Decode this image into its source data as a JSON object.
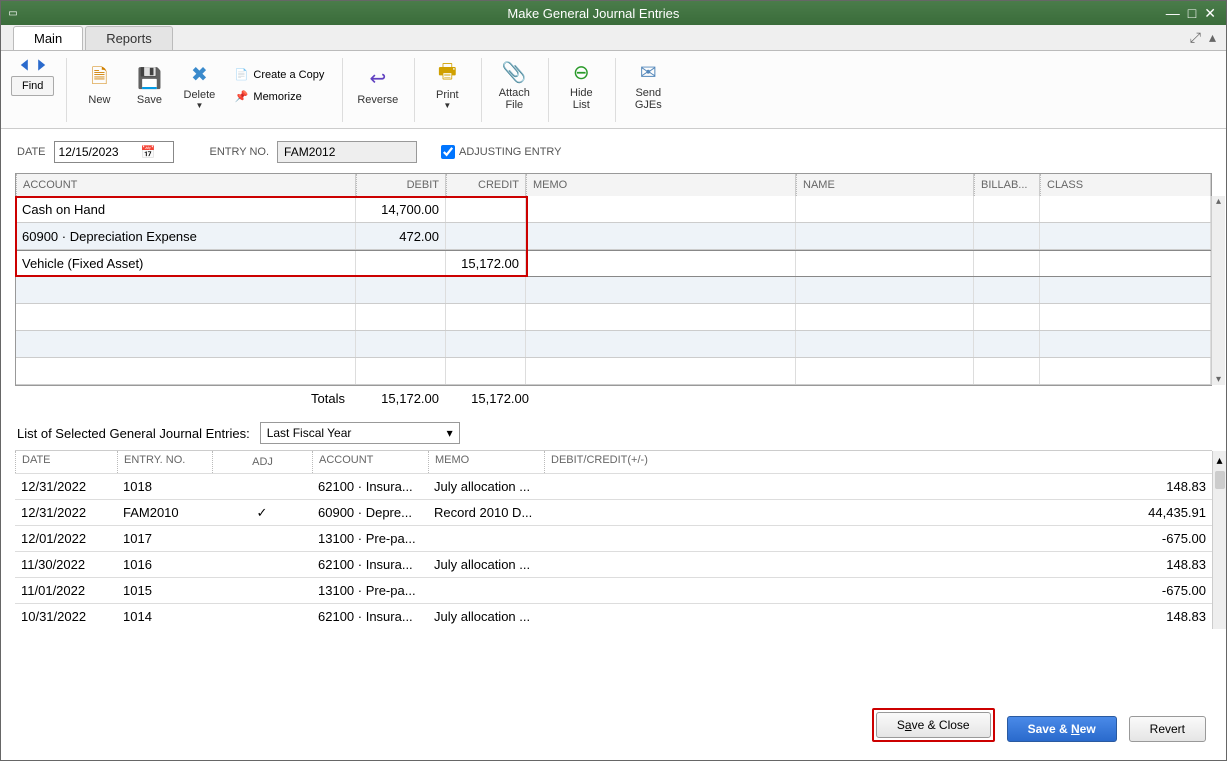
{
  "window": {
    "title": "Make General Journal Entries"
  },
  "tabs": {
    "main": "Main",
    "reports": "Reports"
  },
  "toolbar": {
    "find": "Find",
    "new": "New",
    "save": "Save",
    "delete": "Delete",
    "create_copy": "Create a Copy",
    "memorize": "Memorize",
    "reverse": "Reverse",
    "print": "Print",
    "attach_file_l1": "Attach",
    "attach_file_l2": "File",
    "hide_list_l1": "Hide",
    "hide_list_l2": "List",
    "send_gjes_l1": "Send",
    "send_gjes_l2": "GJEs"
  },
  "form": {
    "date_label": "DATE",
    "date_value": "12/15/2023",
    "entry_no_label": "ENTRY NO.",
    "entry_no_value": "FAM2012",
    "adjusting_label": "ADJUSTING ENTRY"
  },
  "grid_headers": {
    "account": "ACCOUNT",
    "debit": "DEBIT",
    "credit": "CREDIT",
    "memo": "MEMO",
    "name": "NAME",
    "billable": "BILLAB...",
    "class": "CLASS"
  },
  "entries": [
    {
      "account": "Cash on Hand",
      "debit": "14,700.00",
      "credit": ""
    },
    {
      "account": "60900 · Depreciation Expense",
      "debit": "472.00",
      "credit": ""
    },
    {
      "account": "Vehicle (Fixed Asset)",
      "debit": "",
      "credit": "15,172.00"
    }
  ],
  "totals": {
    "label": "Totals",
    "debit": "15,172.00",
    "credit": "15,172.00"
  },
  "list": {
    "title": "List of Selected General Journal Entries:",
    "dropdown_value": "Last Fiscal Year",
    "headers": {
      "date": "DATE",
      "entry": "ENTRY. NO.",
      "adj": "ADJ",
      "account": "ACCOUNT",
      "memo": "MEMO",
      "dc": "DEBIT/CREDIT(+/-)"
    },
    "rows": [
      {
        "date": "12/31/2022",
        "entry": "1018",
        "adj": "",
        "account": "62100 · Insura...",
        "memo": "July allocation ...",
        "dc": "148.83"
      },
      {
        "date": "12/31/2022",
        "entry": "FAM2010",
        "adj": "✓",
        "account": "60900 · Depre...",
        "memo": "Record 2010 D...",
        "dc": "44,435.91"
      },
      {
        "date": "12/01/2022",
        "entry": "1017",
        "adj": "",
        "account": "13100 · Pre-pa...",
        "memo": "",
        "dc": "-675.00"
      },
      {
        "date": "11/30/2022",
        "entry": "1016",
        "adj": "",
        "account": "62100 · Insura...",
        "memo": "July allocation ...",
        "dc": "148.83"
      },
      {
        "date": "11/01/2022",
        "entry": "1015",
        "adj": "",
        "account": "13100 · Pre-pa...",
        "memo": "",
        "dc": "-675.00"
      },
      {
        "date": "10/31/2022",
        "entry": "1014",
        "adj": "",
        "account": "62100 · Insura...",
        "memo": "July allocation ...",
        "dc": "148.83"
      }
    ]
  },
  "footer": {
    "save_close": "Save & Close",
    "save_new": "Save & New",
    "revert": "Revert"
  }
}
